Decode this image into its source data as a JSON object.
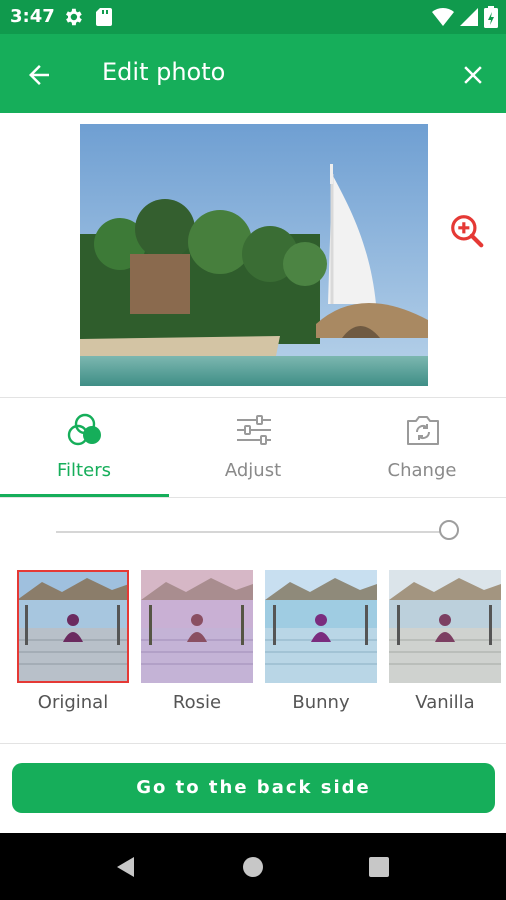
{
  "status_bar": {
    "time": "3:47",
    "icons": [
      "gear-icon",
      "sd-card-icon",
      "wifi-icon",
      "signal-icon",
      "battery-icon"
    ]
  },
  "app_bar": {
    "title": "Edit photo",
    "back_icon": "arrow-back-icon",
    "close_icon": "close-icon"
  },
  "preview": {
    "image": "photo-preview",
    "zoom_icon": "zoom-in-icon",
    "zoom_color": "#E53935"
  },
  "tabs": [
    {
      "label": "Filters",
      "icon": "filters-icon",
      "active": true
    },
    {
      "label": "Adjust",
      "icon": "adjust-icon",
      "active": false
    },
    {
      "label": "Change",
      "icon": "change-photo-icon",
      "active": false
    }
  ],
  "intensity_slider": {
    "value": 1.0
  },
  "filters": [
    {
      "label": "Original",
      "selected": true
    },
    {
      "label": "Rosie",
      "selected": false
    },
    {
      "label": "Bunny",
      "selected": false
    },
    {
      "label": "Vanilla",
      "selected": false
    }
  ],
  "primary_button": {
    "label": "Go to the back side"
  },
  "colors": {
    "status_bar": "#109A4D",
    "accent": "#16AE5A",
    "selected_outline": "#E53935"
  },
  "nav_bar": {
    "icons": [
      "nav-back-icon",
      "nav-home-icon",
      "nav-recents-icon"
    ]
  }
}
